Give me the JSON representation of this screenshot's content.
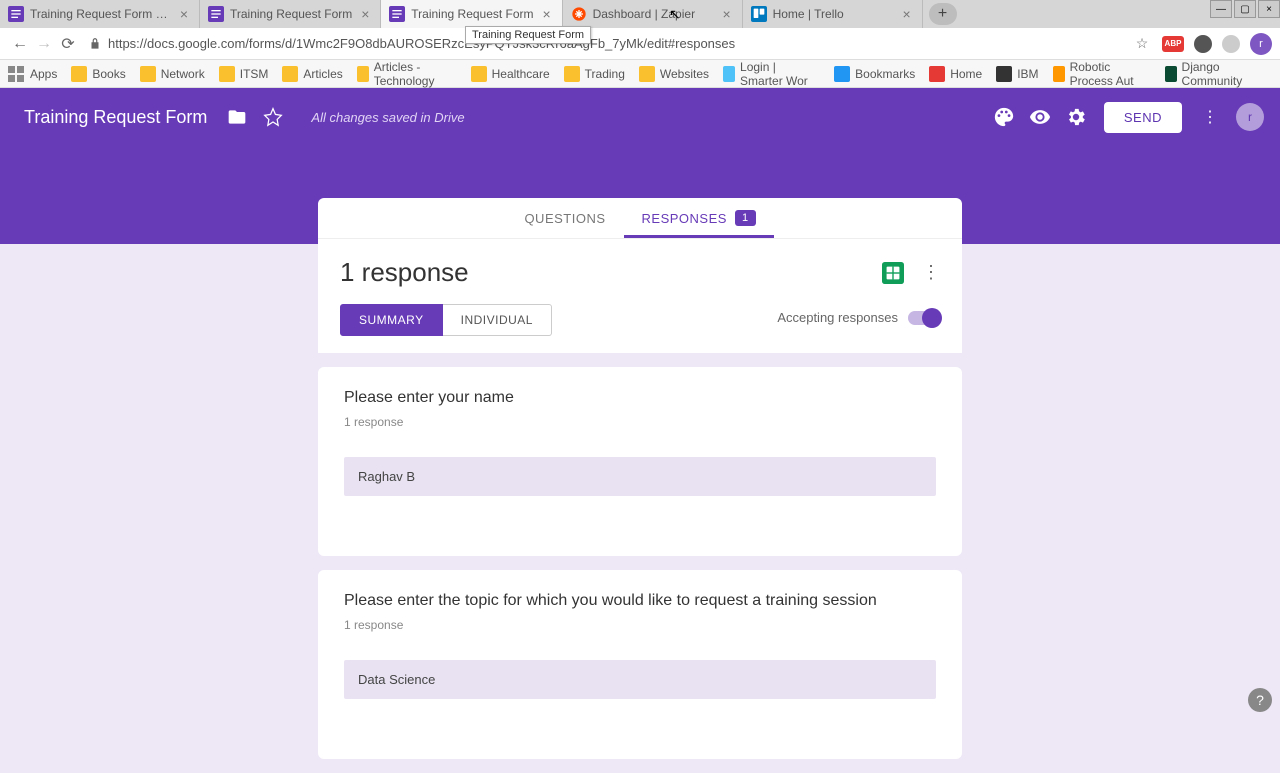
{
  "browser": {
    "tabs": [
      {
        "title": "Training Request Form - Google",
        "icon": "forms"
      },
      {
        "title": "Training Request Form",
        "icon": "forms"
      },
      {
        "title": "Training Request Form",
        "icon": "forms",
        "active": true
      },
      {
        "title": "Dashboard | Zapier",
        "icon": "zapier"
      },
      {
        "title": "Home | Trello",
        "icon": "trello"
      }
    ],
    "url": "https://docs.google.com/forms/d/1Wmc2F9O8dbAUROSERzcEsyPQTJsk3cRr6aAgFb_7yMk/edit#responses",
    "tooltip": "Training Request Form",
    "bookmarks": [
      {
        "label": "Apps"
      },
      {
        "label": "Books"
      },
      {
        "label": "Network"
      },
      {
        "label": "ITSM"
      },
      {
        "label": "Articles"
      },
      {
        "label": "Articles - Technology"
      },
      {
        "label": "Healthcare"
      },
      {
        "label": "Trading"
      },
      {
        "label": "Websites"
      },
      {
        "label": "Login | Smarter Wor"
      },
      {
        "label": "Bookmarks"
      },
      {
        "label": "Home"
      },
      {
        "label": "IBM"
      },
      {
        "label": "Robotic Process Aut"
      },
      {
        "label": "Django Community"
      }
    ],
    "extensions": {
      "abp": "ABP"
    }
  },
  "header": {
    "title": "Training Request Form",
    "save_status": "All changes saved in Drive",
    "send_label": "SEND",
    "avatar_letter": "r"
  },
  "tabs": {
    "questions": "QUESTIONS",
    "responses": "RESPONSES",
    "badge": "1"
  },
  "responses": {
    "count_label": "1 response",
    "summary": "SUMMARY",
    "individual": "INDIVIDUAL",
    "accepting_label": "Accepting responses"
  },
  "questions": [
    {
      "title": "Please enter your name",
      "count": "1 response",
      "answer": "Raghav B"
    },
    {
      "title": "Please enter the topic for which you would like to request a training session",
      "count": "1 response",
      "answer": "Data Science"
    }
  ]
}
